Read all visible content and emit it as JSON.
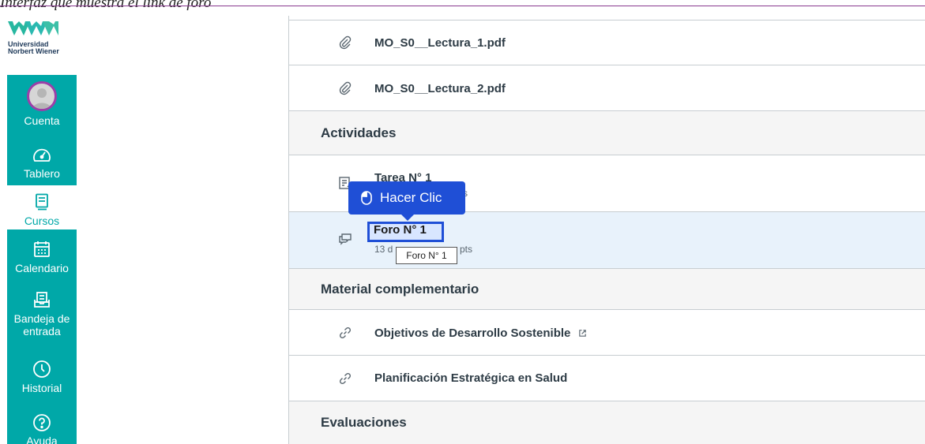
{
  "caption": "Interfaz que muestra el link de foro",
  "logo": {
    "line1": "Universidad",
    "line2": "Norbert Wiener"
  },
  "nav": [
    {
      "label": "Cuenta",
      "icon": "avatar"
    },
    {
      "label": "Tablero",
      "icon": "dashboard-icon"
    },
    {
      "label": "Cursos",
      "icon": "courses-icon"
    },
    {
      "label": "Calendario",
      "icon": "calendar-icon"
    },
    {
      "label": "Bandeja de entrada",
      "line1": "Bandeja de",
      "line2": "entrada",
      "icon": "inbox-icon"
    },
    {
      "label": "Historial",
      "icon": "clock-icon"
    },
    {
      "label": "Ayuda",
      "icon": "help-icon"
    }
  ],
  "files": [
    {
      "title": "MO_S0__Lectura_1.pdf",
      "icon": "paperclip-icon"
    },
    {
      "title": "MO_S0__Lectura_2.pdf",
      "icon": "paperclip-icon"
    }
  ],
  "sections": {
    "actividades": "Actividades",
    "material": "Material complementario",
    "evaluaciones": "Evaluaciones"
  },
  "activities": [
    {
      "title": "Tarea N° 1",
      "sub": "s",
      "icon": "assignment-icon"
    },
    {
      "title": "Foro N° 1",
      "sub_start": "13 d",
      "sub_end": "pts",
      "icon": "discussion-icon"
    }
  ],
  "materials": [
    {
      "title": "Objetivos de Desarrollo Sostenible",
      "icon": "link-icon",
      "external": "external-link-icon"
    },
    {
      "title": "Planificación Estratégica en Salud",
      "icon": "link-icon"
    }
  ],
  "callout": {
    "label": "Hacer Clic",
    "icon": "mouse-icon"
  },
  "tooltip": "Foro N° 1",
  "colors": {
    "nav": "#00a8a8",
    "accent": "#1f4fd6",
    "avatar_ring": "#9b3fa8"
  }
}
